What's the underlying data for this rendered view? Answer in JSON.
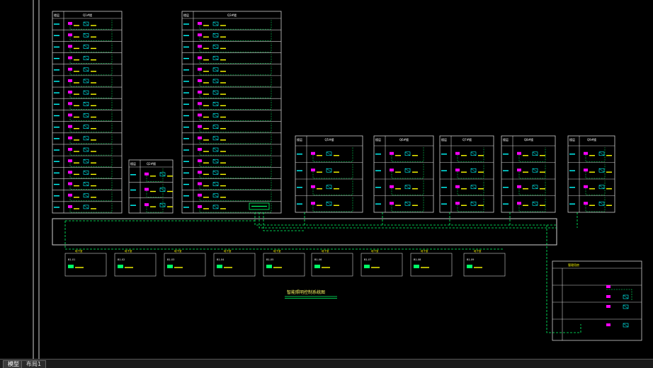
{
  "drawing": {
    "title": "智能照明控制系统图",
    "colors": {
      "frame": "#cfcfcf",
      "wire": "#00ff66",
      "device": "#ff00ff",
      "panel": "#00ff66",
      "label_yellow": "#ffff00",
      "label_cyan": "#00ffff"
    }
  },
  "buildings": [
    {
      "name": "Q1#楼",
      "floor_header": "楼层"
    },
    {
      "name": "Q2#楼",
      "floor_header": "楼层"
    },
    {
      "name": "Q3#楼",
      "floor_header": "楼层"
    },
    {
      "name": "Q5#楼",
      "floor_header": "楼层"
    },
    {
      "name": "Q6#楼",
      "floor_header": "楼层"
    },
    {
      "name": "Q7#楼",
      "floor_header": "楼层"
    },
    {
      "name": "Q8#楼",
      "floor_header": "楼层"
    },
    {
      "name": "Q9#楼",
      "floor_header": "楼层"
    }
  ],
  "basement_panels": [
    {
      "title": "地下室",
      "label": "B1-01"
    },
    {
      "title": "地下室",
      "label": "B1-02"
    },
    {
      "title": "地下室",
      "label": "B1-03"
    },
    {
      "title": "地下室",
      "label": "B1-04"
    },
    {
      "title": "地下室",
      "label": "B1-05"
    },
    {
      "title": "地下室",
      "label": "B1-06"
    },
    {
      "title": "地下室",
      "label": "B1-07"
    },
    {
      "title": "地下室",
      "label": "B1-08"
    },
    {
      "title": "地下室",
      "label": "B1-09"
    }
  ],
  "side_panel": {
    "title": "管理用房"
  },
  "tabs": {
    "model": "模型",
    "layout": "布局1"
  }
}
